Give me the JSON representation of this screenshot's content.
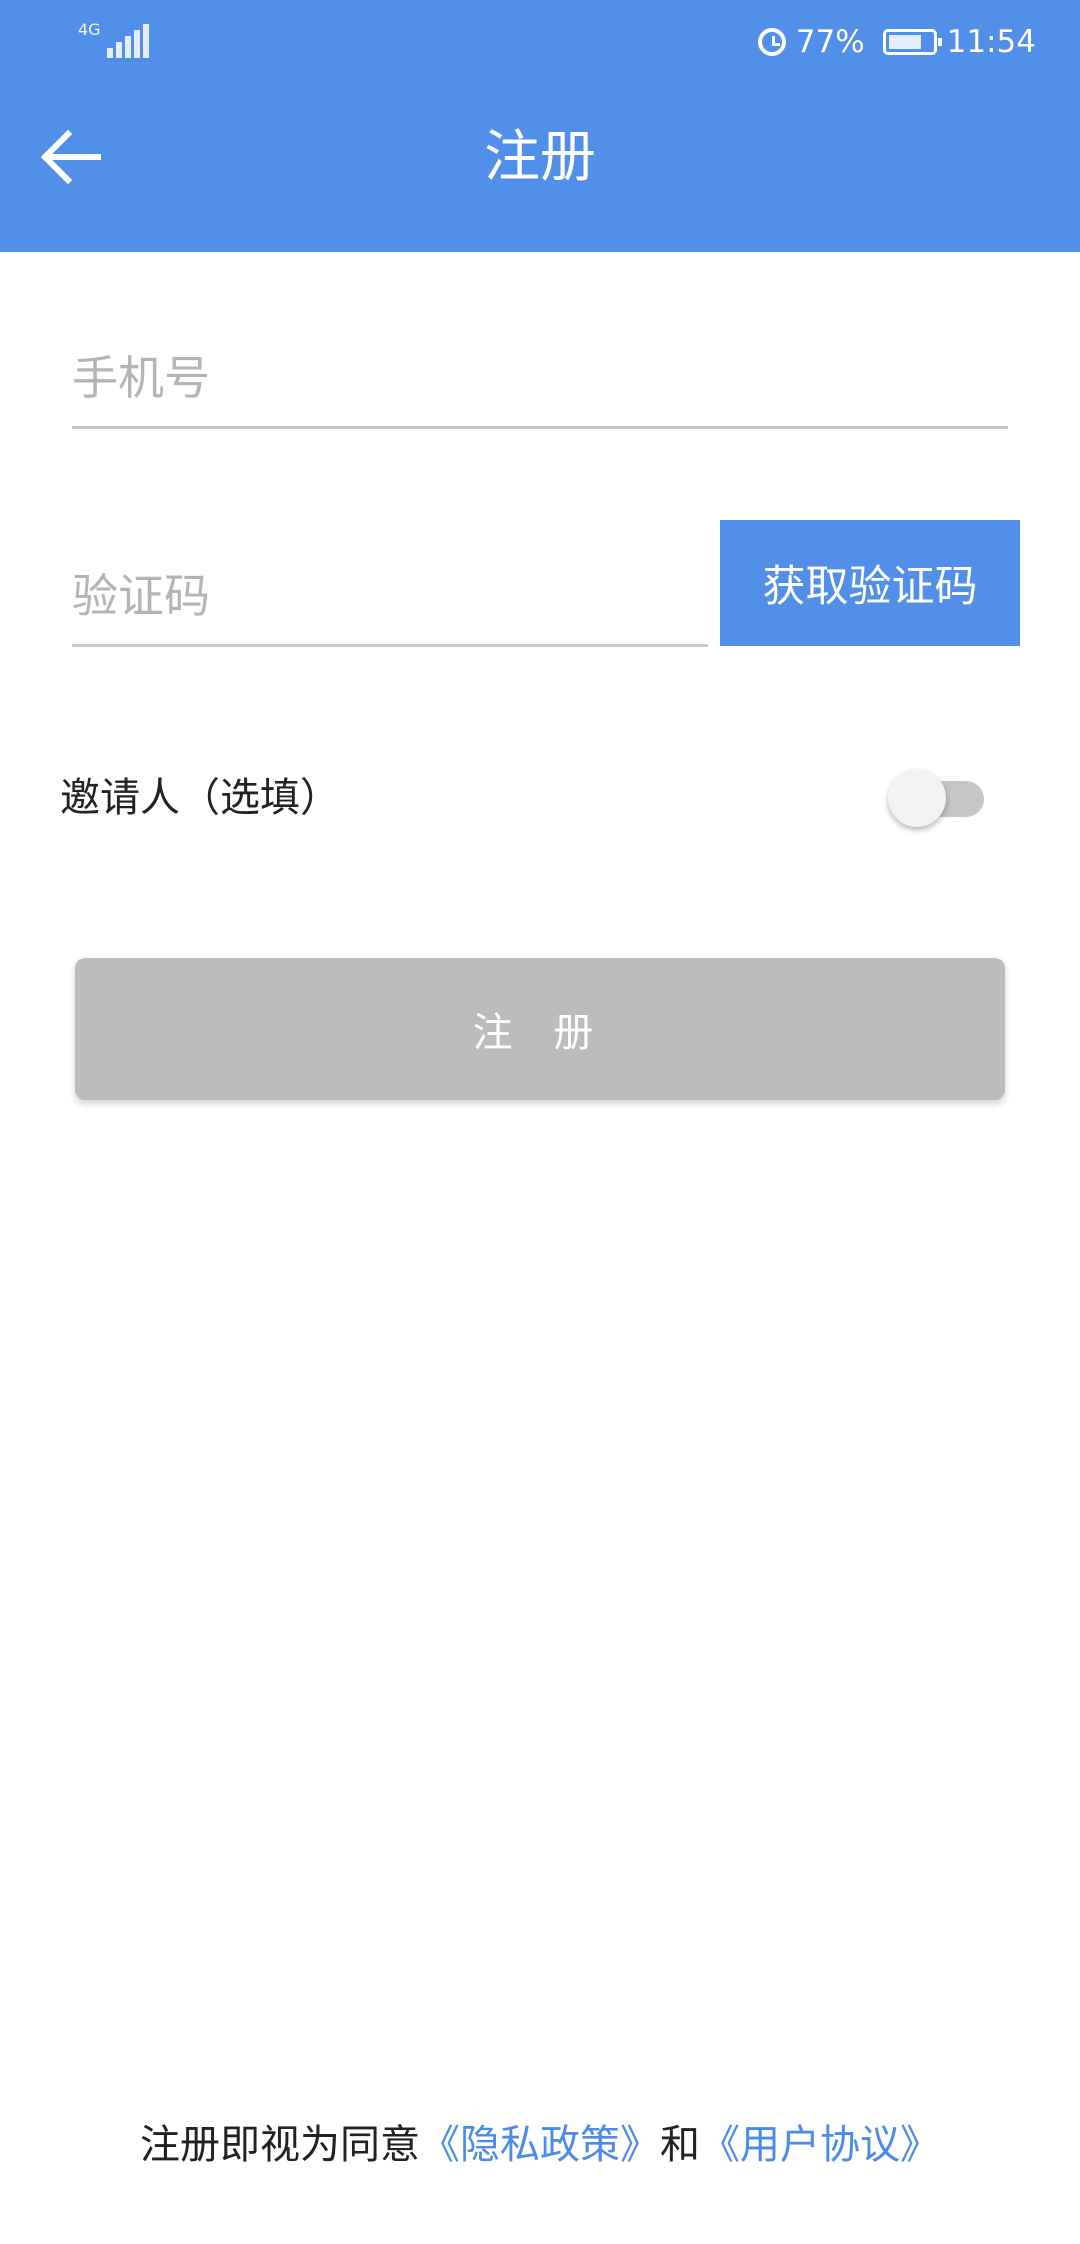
{
  "status_bar": {
    "network_type": "4G",
    "battery_percent": "77%",
    "battery_level": 0.77,
    "time": "11:54",
    "icons": [
      "signal-icon",
      "alarm-icon",
      "battery-icon"
    ]
  },
  "header": {
    "title": "注册",
    "back_icon": "arrow-left-icon"
  },
  "form": {
    "phone_placeholder": "手机号",
    "phone_value": "",
    "code_placeholder": "验证码",
    "code_value": "",
    "get_code_label": "获取验证码",
    "inviter_label": "邀请人（选填）",
    "inviter_toggle_on": false,
    "register_label": "注 册"
  },
  "agreement": {
    "prefix": "注册即视为同意",
    "privacy_link": "《隐私政策》",
    "connector": "和",
    "terms_link": "《用户协议》"
  },
  "colors": {
    "primary": "#518fe9",
    "link": "#4b8ce8",
    "button_disabled": "#bbbcbd",
    "placeholder": "#b4b4b4",
    "underline": "#c8c8c8"
  }
}
